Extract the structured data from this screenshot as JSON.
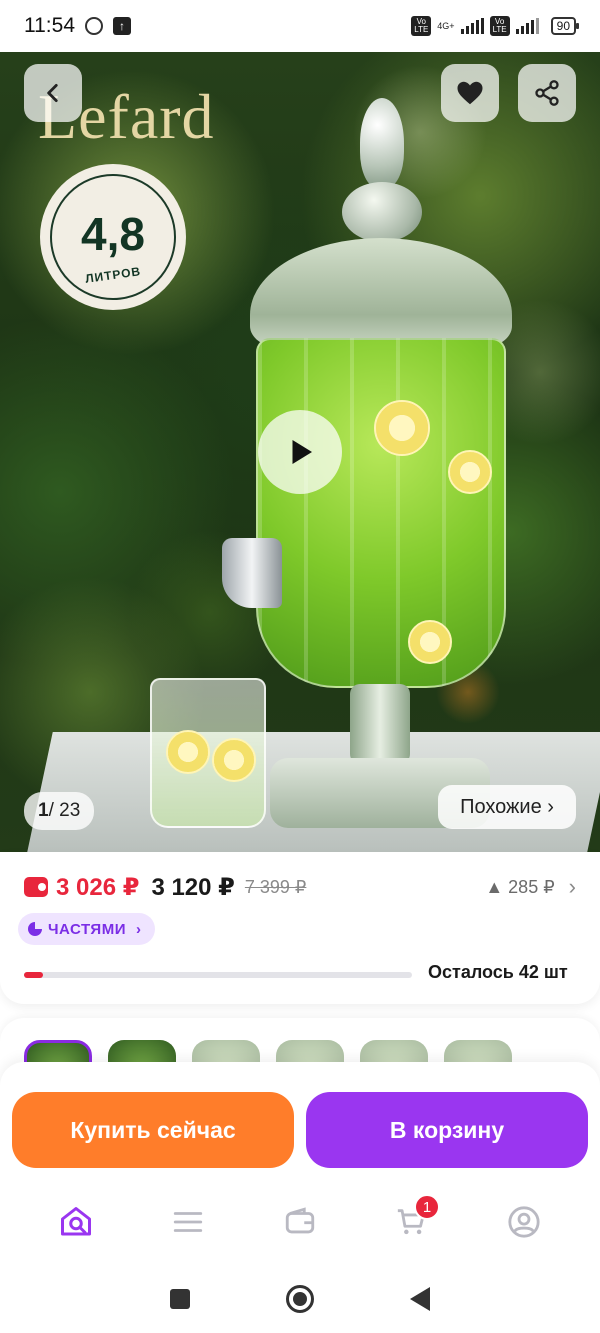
{
  "status_bar": {
    "time": "11:54",
    "net_type": "4G+",
    "battery": "90"
  },
  "product": {
    "brand": "Lefard",
    "volume_value": "4,8",
    "volume_unit": "ЛИТРОВ",
    "image_counter_current": "1",
    "image_counter_total": "/ 23",
    "similar_label": "Похожие ›"
  },
  "price": {
    "card_price": "3 026 ₽",
    "price": "3 120 ₽",
    "old_price": "7 399 ₽",
    "delta": "▲ 285 ₽",
    "parts_label": "ЧАСТЯМИ",
    "stock_text": "Осталось 42 шт",
    "stock_fraction": 0.05
  },
  "actions": {
    "buy_now": "Купить сейчас",
    "to_cart": "В корзину"
  },
  "nav": {
    "cart_badge": "1",
    "items": [
      "home-search-icon",
      "catalog-icon",
      "wallet-icon",
      "cart-icon",
      "profile-icon"
    ]
  },
  "colors": {
    "accent_purple": "#9a36f0",
    "accent_orange": "#ff7d2a",
    "price_red": "#e8263c"
  }
}
